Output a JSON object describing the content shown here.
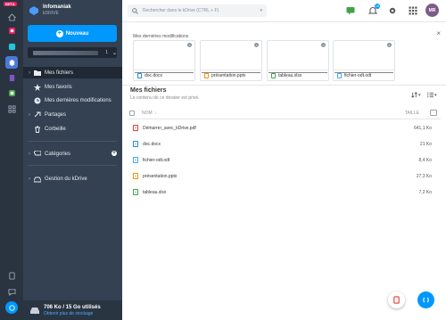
{
  "rail": {
    "beta_label": "BETA",
    "icons": [
      "home-icon",
      "photo-icon",
      "drive-icon",
      "kdrive-icon",
      "mail-icon",
      "calendar-icon",
      "apps-icon",
      "help-icon",
      "chat-icon",
      "support-icon"
    ]
  },
  "brand": {
    "name": "Infomaniak",
    "product": "kDRIVE"
  },
  "new_button": {
    "label": "Nouveau"
  },
  "drive_selector": {
    "value": "1"
  },
  "nav": {
    "my_files": "Mes fichiers",
    "favorites": "Mes favoris",
    "recent": "Mes dernières modifications",
    "shared": "Partages",
    "trash": "Corbeille",
    "categories": "Catégories",
    "manage": "Gestion du kDrive"
  },
  "storage": {
    "used": "706 Ko / 15 Go utilisés",
    "link": "Obtenir plus de stockage"
  },
  "search": {
    "placeholder": "Rechercher dans le kDrive (CTRL + F)"
  },
  "notifications": {
    "count": "15"
  },
  "user": {
    "initials": "MR"
  },
  "recent": {
    "title": "Mes dernières modifications",
    "cards": [
      {
        "name": "doc.docx",
        "type": "doc"
      },
      {
        "name": "présentation.pptx",
        "type": "ppt"
      },
      {
        "name": "tableau.xlsx",
        "type": "xls"
      },
      {
        "name": "fichier-odt.odt",
        "type": "odt"
      }
    ]
  },
  "files": {
    "title": "Mes fichiers",
    "subtitle": "Le contenu de ce dossier est privé.",
    "col_name": "NOM",
    "col_size": "TAILLE",
    "rows": [
      {
        "name": "Démarrer_avec_kDrive.pdf",
        "size": "641,1 Ko",
        "type": "pdf"
      },
      {
        "name": "doc.docx",
        "size": "21 Ko",
        "type": "doc"
      },
      {
        "name": "fichier-odt.odt",
        "size": "8,4 Ko",
        "type": "odt"
      },
      {
        "name": "présentation.pptx",
        "size": "27,3 Ko",
        "type": "ppt"
      },
      {
        "name": "tableau.xlsx",
        "size": "7,2 Ko",
        "type": "xls"
      }
    ]
  },
  "colors": {
    "accent": "#0098ff",
    "rail_bg": "#2a3340",
    "panel_bg": "#334152",
    "panel_active": "#1f2833"
  }
}
